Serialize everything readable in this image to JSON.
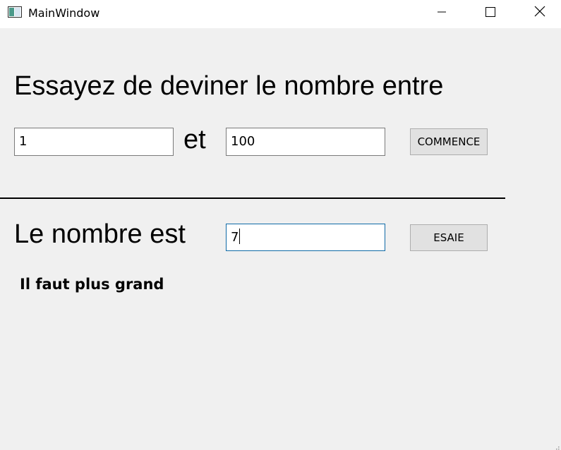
{
  "window": {
    "title": "MainWindow"
  },
  "range": {
    "heading": "Essayez de deviner le nombre entre",
    "min_value": "1",
    "separator": "et",
    "max_value": "100",
    "start_label": "COMMENCE"
  },
  "guess": {
    "label": "Le nombre est",
    "value": "7",
    "try_label": "ESAIE"
  },
  "result": {
    "message": "Il faut plus grand"
  },
  "icons": {
    "app": "app-window-icon",
    "minimize": "minimize-icon",
    "maximize": "maximize-icon",
    "close": "close-icon",
    "resize": "resize-grip-icon"
  },
  "colors": {
    "background": "#f0f0f0",
    "titlebar": "#ffffff",
    "focus_border": "#0f6aa6",
    "button_bg": "#e1e1e1"
  }
}
